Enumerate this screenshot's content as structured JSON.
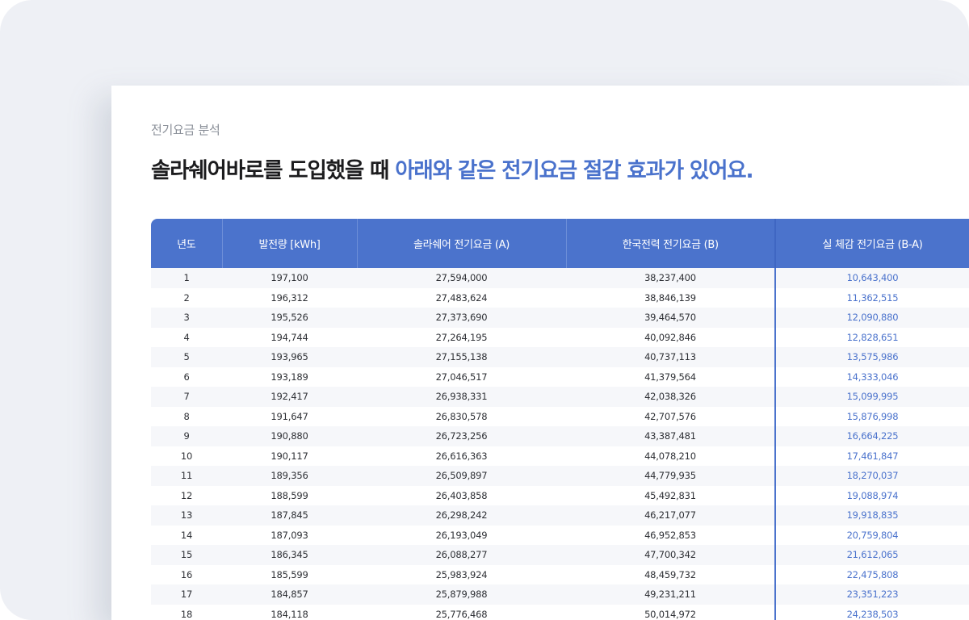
{
  "section": {
    "eyebrow": "전기요금 분석",
    "headline_dark": "솔라쉐어바로를 도입했을 때 ",
    "headline_accent": "아래와 같은 전기요금 절감 효과가 있어요."
  },
  "table": {
    "headers": {
      "year": "년도",
      "generation": "발전량 [kWh]",
      "solar_fee": "솔라쉐어 전기요금 (A)",
      "kepco_fee": "한국전력 전기요금 (B)",
      "saving": "실 체감 전기요금 (B-A)"
    },
    "rows": [
      {
        "year": "1",
        "generation": "197,100",
        "solar_fee": "27,594,000",
        "kepco_fee": "38,237,400",
        "saving": "10,643,400"
      },
      {
        "year": "2",
        "generation": "196,312",
        "solar_fee": "27,483,624",
        "kepco_fee": "38,846,139",
        "saving": "11,362,515"
      },
      {
        "year": "3",
        "generation": "195,526",
        "solar_fee": "27,373,690",
        "kepco_fee": "39,464,570",
        "saving": "12,090,880"
      },
      {
        "year": "4",
        "generation": "194,744",
        "solar_fee": "27,264,195",
        "kepco_fee": "40,092,846",
        "saving": "12,828,651"
      },
      {
        "year": "5",
        "generation": "193,965",
        "solar_fee": "27,155,138",
        "kepco_fee": "40,737,113",
        "saving": "13,575,986"
      },
      {
        "year": "6",
        "generation": "193,189",
        "solar_fee": "27,046,517",
        "kepco_fee": "41,379,564",
        "saving": "14,333,046"
      },
      {
        "year": "7",
        "generation": "192,417",
        "solar_fee": "26,938,331",
        "kepco_fee": "42,038,326",
        "saving": "15,099,995"
      },
      {
        "year": "8",
        "generation": "191,647",
        "solar_fee": "26,830,578",
        "kepco_fee": "42,707,576",
        "saving": "15,876,998"
      },
      {
        "year": "9",
        "generation": "190,880",
        "solar_fee": "26,723,256",
        "kepco_fee": "43,387,481",
        "saving": "16,664,225"
      },
      {
        "year": "10",
        "generation": "190,117",
        "solar_fee": "26,616,363",
        "kepco_fee": "44,078,210",
        "saving": "17,461,847"
      },
      {
        "year": "11",
        "generation": "189,356",
        "solar_fee": "26,509,897",
        "kepco_fee": "44,779,935",
        "saving": "18,270,037"
      },
      {
        "year": "12",
        "generation": "188,599",
        "solar_fee": "26,403,858",
        "kepco_fee": "45,492,831",
        "saving": "19,088,974"
      },
      {
        "year": "13",
        "generation": "187,845",
        "solar_fee": "26,298,242",
        "kepco_fee": "46,217,077",
        "saving": "19,918,835"
      },
      {
        "year": "14",
        "generation": "187,093",
        "solar_fee": "26,193,049",
        "kepco_fee": "46,952,853",
        "saving": "20,759,804"
      },
      {
        "year": "15",
        "generation": "186,345",
        "solar_fee": "26,088,277",
        "kepco_fee": "47,700,342",
        "saving": "21,612,065"
      },
      {
        "year": "16",
        "generation": "185,599",
        "solar_fee": "25,983,924",
        "kepco_fee": "48,459,732",
        "saving": "22,475,808"
      },
      {
        "year": "17",
        "generation": "184,857",
        "solar_fee": "25,879,988",
        "kepco_fee": "49,231,211",
        "saving": "23,351,223"
      },
      {
        "year": "18",
        "generation": "184,118",
        "solar_fee": "25,776,468",
        "kepco_fee": "50,014,972",
        "saving": "24,238,503"
      }
    ]
  },
  "colors": {
    "accent": "#4a72cc",
    "header_bg": "#4b73cc",
    "stripe": "#f6f7fa",
    "frame_bg": "#eef0f5"
  }
}
